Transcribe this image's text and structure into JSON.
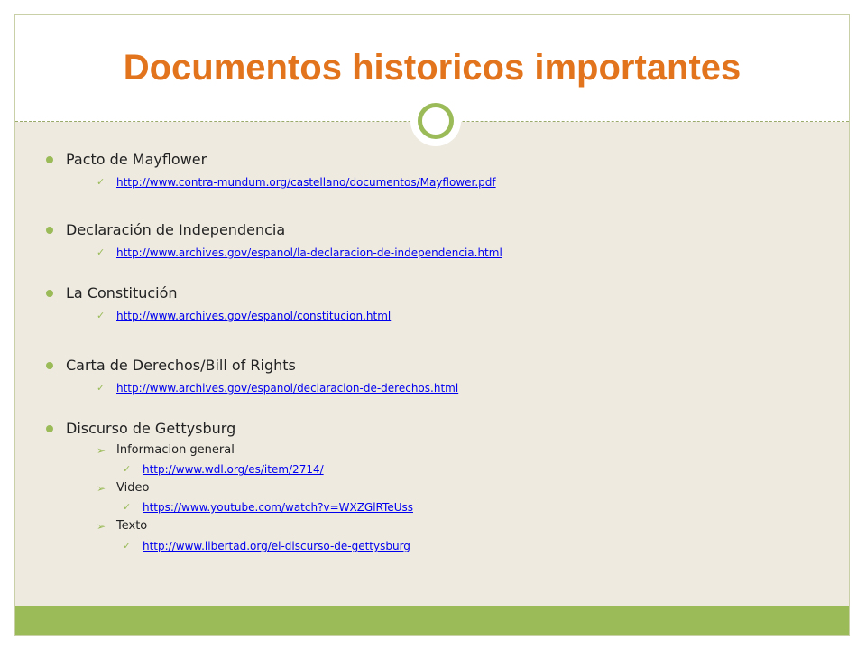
{
  "title": "Documentos historicos importantes",
  "items": [
    {
      "heading": "Pacto de Mayflower",
      "link": "http://www.contra-mundum.org/castellano/documentos/Mayflower.pdf"
    },
    {
      "heading": "Declaración de Independencia",
      "link": "http://www.archives.gov/espanol/la-declaracion-de-independencia.html"
    },
    {
      "heading": "La Constitución",
      "link": "http://www.archives.gov/espanol/constitucion.html"
    },
    {
      "heading": "Carta de Derechos/Bill of Rights",
      "link": "http://www.archives.gov/espanol/declaracion-de-derechos.html"
    },
    {
      "heading": "Discurso de Gettysburg",
      "subitems": [
        {
          "label": "Informacion general",
          "link": "http://www.wdl.org/es/item/2714/"
        },
        {
          "label": "Video",
          "link": "https://www.youtube.com/watch?v=WXZGlRTeUss"
        },
        {
          "label": "Texto",
          "link": "http://www.libertad.org/el-discurso-de-gettysburg"
        }
      ]
    }
  ],
  "colors": {
    "title": "#e2741d",
    "accent": "#9bbb59",
    "content_bg": "#eeeae0",
    "link": "#0000ee"
  }
}
